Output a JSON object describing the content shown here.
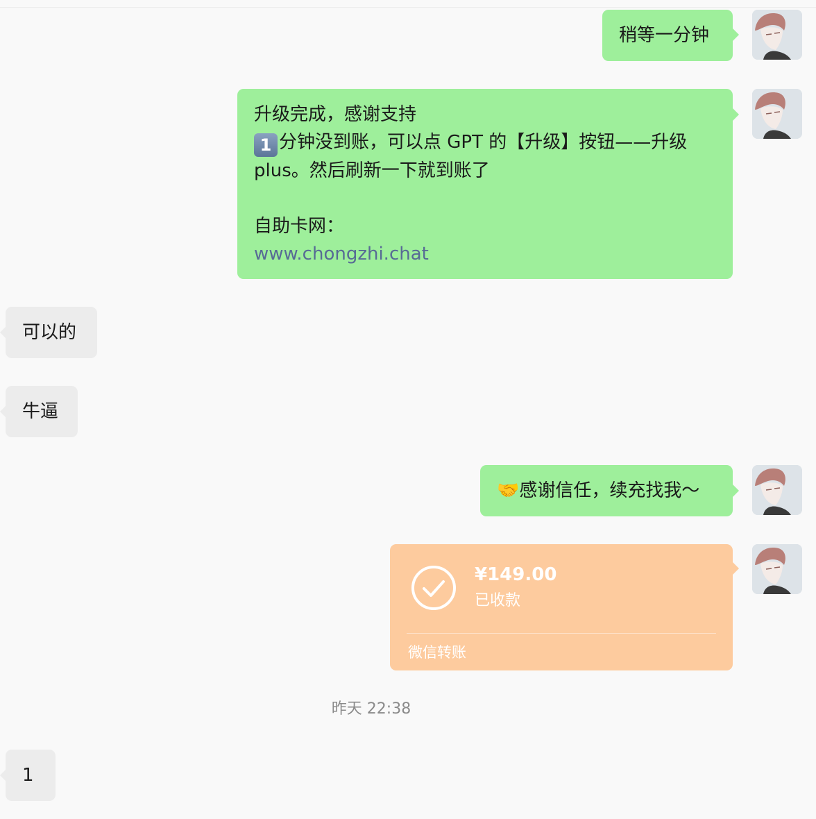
{
  "messages": {
    "m1": {
      "text": "稍等一分钟"
    },
    "m2": {
      "line1": "升级完成，感谢支持",
      "badge": "1",
      "line2": "分钟没到账，可以点 GPT 的【升级】按钮——升级",
      "line3": "plus。然后刷新一下就到账了",
      "line4": "自助卡网：",
      "link": "www.chongzhi.chat"
    },
    "m3": {
      "text": "可以的"
    },
    "m4": {
      "text": "牛逼"
    },
    "m5": {
      "emoji": "🤝",
      "text": "感谢信任，续充找我～"
    },
    "m6": {
      "amount": "¥149.00",
      "status": "已收款",
      "footer": "微信转账"
    },
    "m7": {
      "text": "1"
    }
  },
  "timestamp": "昨天 22:38",
  "colors": {
    "background": "#f9f9f9",
    "sent_bubble": "#9eef9b",
    "received_bubble": "#ececec",
    "transfer_bubble": "#fdcb9e",
    "link": "#576b95",
    "timestamp": "#8a8a8a"
  },
  "icons": {
    "avatar": "avatar",
    "transfer_received": "check-circle-icon",
    "badge": "keycap-one-icon",
    "handshake": "handshake-emoji"
  }
}
